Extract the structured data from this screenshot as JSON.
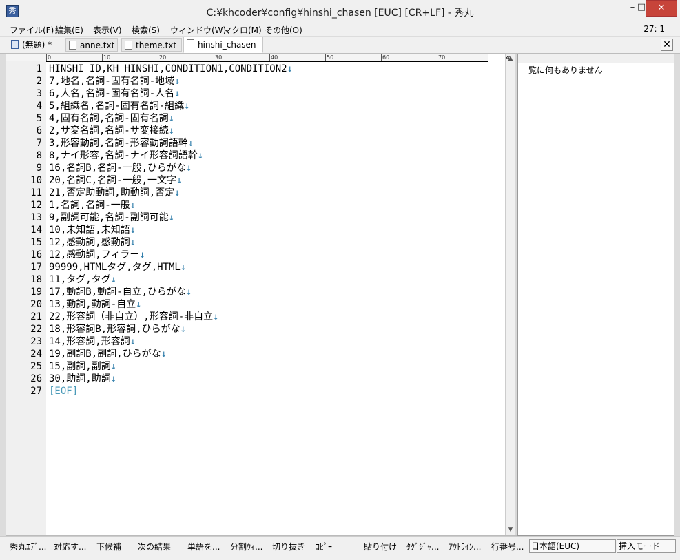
{
  "window": {
    "title": "C:¥khcoder¥config¥hinshi_chasen [EUC] [CR+LF] - 秀丸",
    "min_label": "–",
    "max_label": "□",
    "close_label": "✕"
  },
  "menu": {
    "items": [
      "ファイル(F)",
      "編集(E)",
      "表示(V)",
      "検索(S)",
      "ウィンドウ(W)",
      "マクロ(M)",
      "その他(O)"
    ],
    "cursor_pos": "27: 1"
  },
  "tabs": {
    "untitled": "(無題) *",
    "anne": "anne.txt",
    "theme": "theme.txt",
    "hinshi": "hinshi_chasen",
    "close": "✕"
  },
  "ruler": {
    "ticks": [
      "0",
      "10",
      "20",
      "30",
      "40",
      "50",
      "60",
      "70"
    ]
  },
  "editor": {
    "newline_mark": "↓",
    "lines": [
      "HINSHI_ID,KH_HINSHI,CONDITION1,CONDITION2",
      "7,地名,名詞-固有名詞-地域",
      "6,人名,名詞-固有名詞-人名",
      "5,組織名,名詞-固有名詞-組織",
      "4,固有名詞,名詞-固有名詞",
      "2,サ変名詞,名詞-サ変接続",
      "3,形容動詞,名詞-形容動詞語幹",
      "8,ナイ形容,名詞-ナイ形容詞語幹",
      "16,名詞B,名詞-一般,ひらがな",
      "20,名詞C,名詞-一般,一文字",
      "21,否定助動詞,助動詞,否定",
      "1,名詞,名詞-一般",
      "9,副詞可能,名詞-副詞可能",
      "10,未知語,未知語",
      "12,感動詞,感動詞",
      "12,感動詞,フィラー",
      "99999,HTMLタグ,タグ,HTML",
      "11,タグ,タグ",
      "17,動詞B,動詞-自立,ひらがな",
      "13,動詞,動詞-自立",
      "22,形容詞（非自立）,形容詞-非自立",
      "18,形容詞B,形容詞,ひらがな",
      "14,形容詞,形容詞",
      "19,副詞B,副詞,ひらがな",
      "15,副詞,副詞",
      "30,助詞,助詞"
    ],
    "eof_label": "[EOF]",
    "eof_line_number": "27"
  },
  "side_panel": {
    "message": "一覧に何もありません",
    "collapse_label": "«"
  },
  "statusbar": {
    "fkeys": [
      "秀丸ｴﾃﾞ...",
      "対応す...",
      "下候補",
      "次の結果",
      "単語を...",
      "分割ｳｨ...",
      "切り抜き",
      "ｺﾋﾟｰ",
      "貼り付け",
      "ﾀｸﾞｼﾞｬ...",
      "ｱｳﾄﾗｲﾝ...",
      "行番号..."
    ],
    "encoding": "日本語(EUC)",
    "mode": "挿入モード"
  }
}
